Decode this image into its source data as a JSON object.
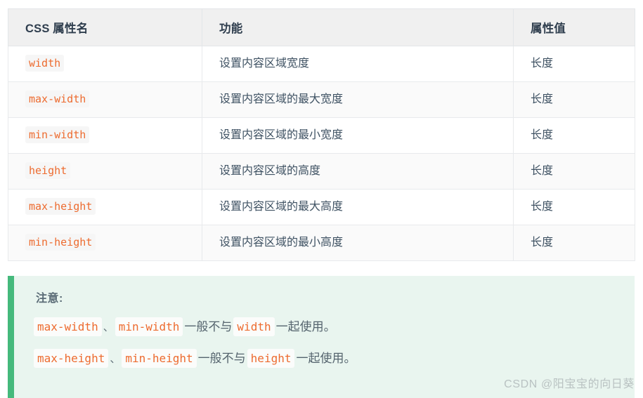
{
  "table": {
    "headers": [
      "CSS 属性名",
      "功能",
      "属性值"
    ],
    "rows": [
      {
        "property": "width",
        "function": "设置内容区域宽度",
        "value": "长度"
      },
      {
        "property": "max-width",
        "function": "设置内容区域的最大宽度",
        "value": "长度"
      },
      {
        "property": "min-width",
        "function": "设置内容区域的最小宽度",
        "value": "长度"
      },
      {
        "property": "height",
        "function": "设置内容区域的高度",
        "value": "长度"
      },
      {
        "property": "max-height",
        "function": "设置内容区域的最大高度",
        "value": "长度"
      },
      {
        "property": "min-height",
        "function": "设置内容区域的最小高度",
        "value": "长度"
      }
    ]
  },
  "note": {
    "title": "注意:",
    "lines": [
      {
        "code1": "max-width",
        "sep1": "、",
        "code2": "min-width",
        "mid": "一般不与",
        "code3": "width",
        "tail": "一起使用。"
      },
      {
        "code1": "max-height",
        "sep1": "、",
        "code2": "min-height",
        "mid": "一般不与",
        "code3": "height",
        "tail": "一起使用。"
      }
    ]
  },
  "watermark": {
    "text": "CSDN @阳宝宝的向日葵"
  },
  "colors": {
    "code_orange": "#ed6b2f",
    "code_chip_bg": "#f6f6f6",
    "note_bg": "#e9f5ef",
    "note_accent": "#45b97c",
    "header_bg": "#f0f0f0",
    "row_alt_bg": "#fafafa",
    "border": "#e3e6e8",
    "text": "#3f5263",
    "watermark": "#b9c2c2"
  }
}
